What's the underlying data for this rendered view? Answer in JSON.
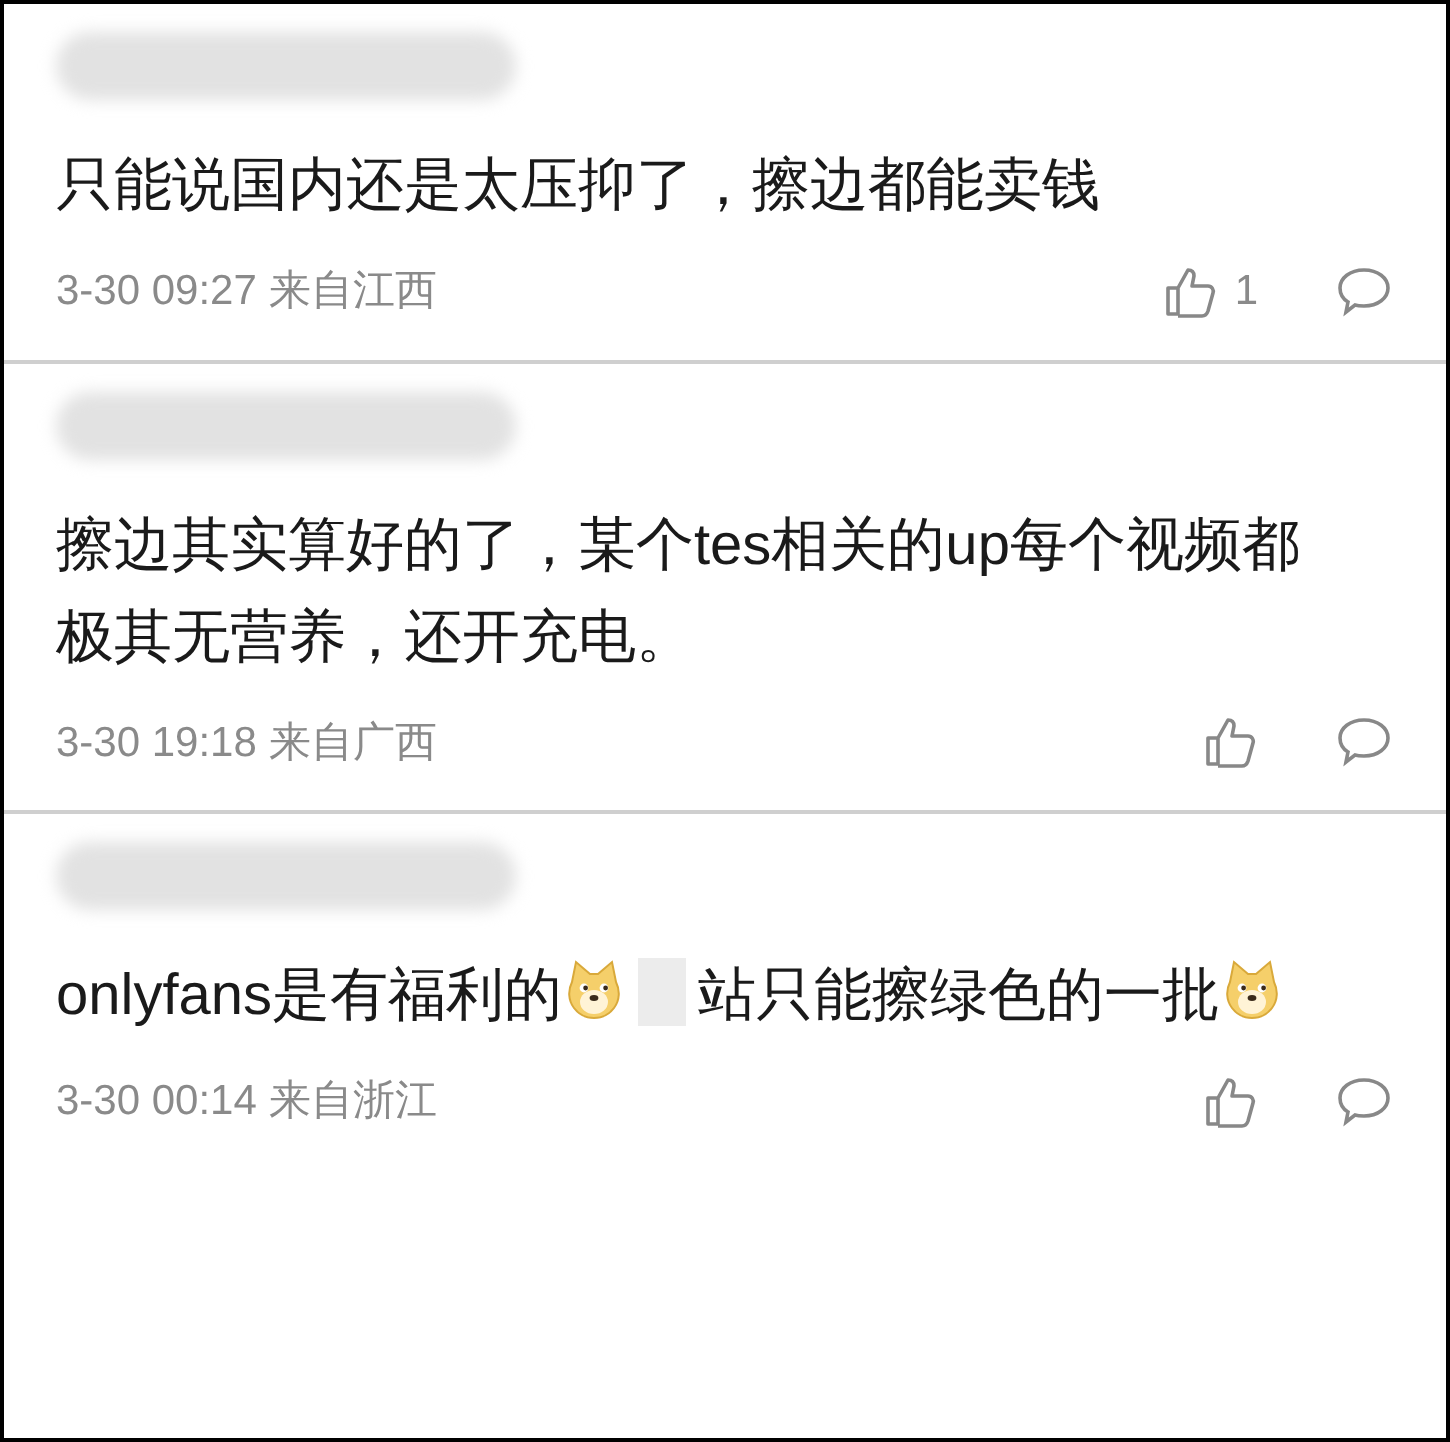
{
  "comments": [
    {
      "segments": [
        {
          "kind": "text",
          "text": "只能说国内还是太压抑了，擦边都能卖钱"
        }
      ],
      "meta": "3-30 09:27 来自江西",
      "likes": "1"
    },
    {
      "segments": [
        {
          "kind": "text",
          "text": "擦边其实算好的了，某个tes相关的up每个视频都极其无营养，还开充电。"
        }
      ],
      "meta": "3-30 19:18 来自广西"
    },
    {
      "segments": [
        {
          "kind": "text",
          "text": "onlyfans是有福利的"
        },
        {
          "kind": "emoji"
        },
        {
          "kind": "redacted"
        },
        {
          "kind": "text",
          "text": "站只能擦绿色的一批"
        },
        {
          "kind": "emoji"
        }
      ],
      "meta": "3-30 00:14 来自浙江"
    }
  ]
}
